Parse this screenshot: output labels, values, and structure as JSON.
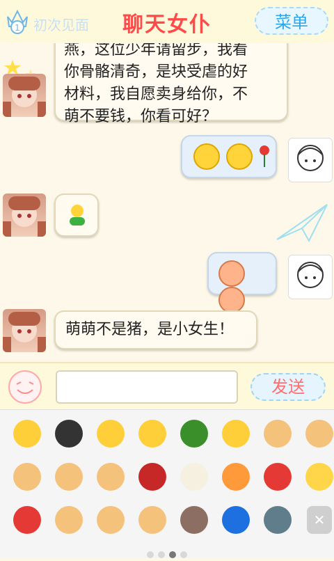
{
  "header": {
    "level_number": "1",
    "level_label": "初次见面",
    "title": "聊天女仆",
    "menu_label": "菜单"
  },
  "messages": [
    {
      "side": "left",
      "text_lines": [
        "燕，这位少年请留步，我看",
        "你骨骼清奇，是块受虐的好",
        "材料，我自愿卖身给你，不",
        "萌不要钱，你看可好？"
      ]
    },
    {
      "side": "right",
      "emojis": [
        "grin-emoji",
        "grin-emoji",
        "rose-emoji"
      ]
    },
    {
      "side": "left",
      "emojis": [
        "green-man-emoji"
      ]
    },
    {
      "side": "right",
      "emojis": [
        "pig-emoji",
        "pig-emoji"
      ]
    },
    {
      "side": "left",
      "text": "萌萌不是猪，是小女生！"
    }
  ],
  "input": {
    "value": "",
    "placeholder": "",
    "send_label": "发送"
  },
  "emoji_panel": {
    "rows": [
      [
        "grin",
        "penguin",
        "angry-face",
        "dizzy-face",
        "green-turtle",
        "crying-face",
        "thumbs-up",
        "thumbs-down"
      ],
      [
        "handshake",
        "victory-hand",
        "beckon-hand",
        "wilted-rose",
        "rice-bowl",
        "birthday-cake",
        "watermelon",
        "gift"
      ],
      [
        "ladybug",
        "fist",
        "ok-hand",
        "rock-hand",
        "coffee",
        "moon",
        "sword",
        "delete"
      ]
    ],
    "page_count": 4,
    "active_page": 2
  },
  "colors": {
    "title": "#ff4a4a",
    "accent": "#2ea7e8",
    "send": "#ff6f6f"
  }
}
